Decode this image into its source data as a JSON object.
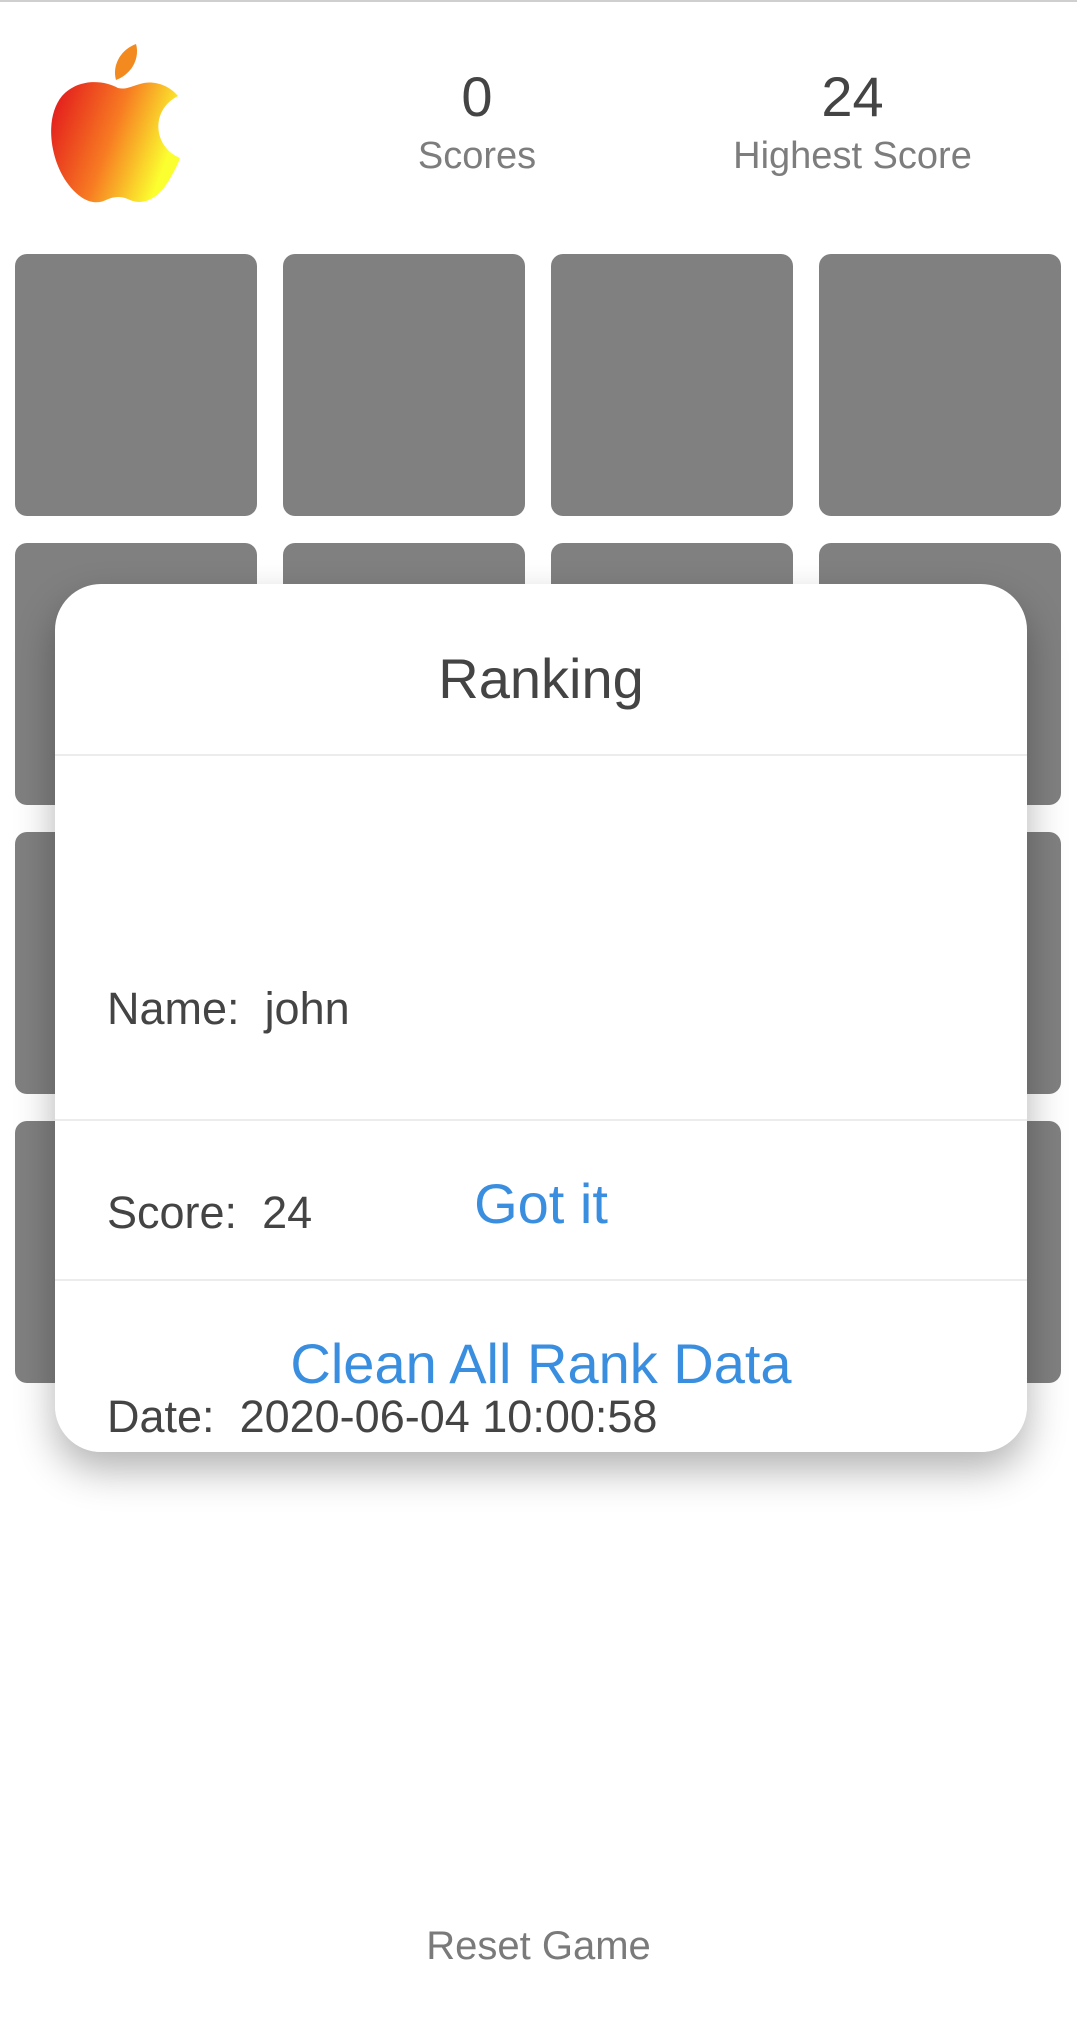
{
  "header": {
    "score_value": "0",
    "score_label": "Scores",
    "highest_value": "24",
    "highest_label": "Highest Score"
  },
  "logo": {
    "icon": "apple-logo-icon"
  },
  "grid": {
    "rows": 4,
    "cols": 4,
    "tile_color": "#808080"
  },
  "dialog": {
    "title": "Ranking",
    "name_label": "Name:",
    "name_value": "john",
    "score_label": "Score:",
    "score_value": "24",
    "date_label": "Date:",
    "date_value": "2020-06-04 10:00:58",
    "got_it_label": "Got it",
    "clean_label": "Clean All Rank Data"
  },
  "footer": {
    "reset_label": "Reset Game"
  },
  "colors": {
    "accent": "#3a8ee0",
    "text": "#444444",
    "muted": "#7d7d7d"
  }
}
